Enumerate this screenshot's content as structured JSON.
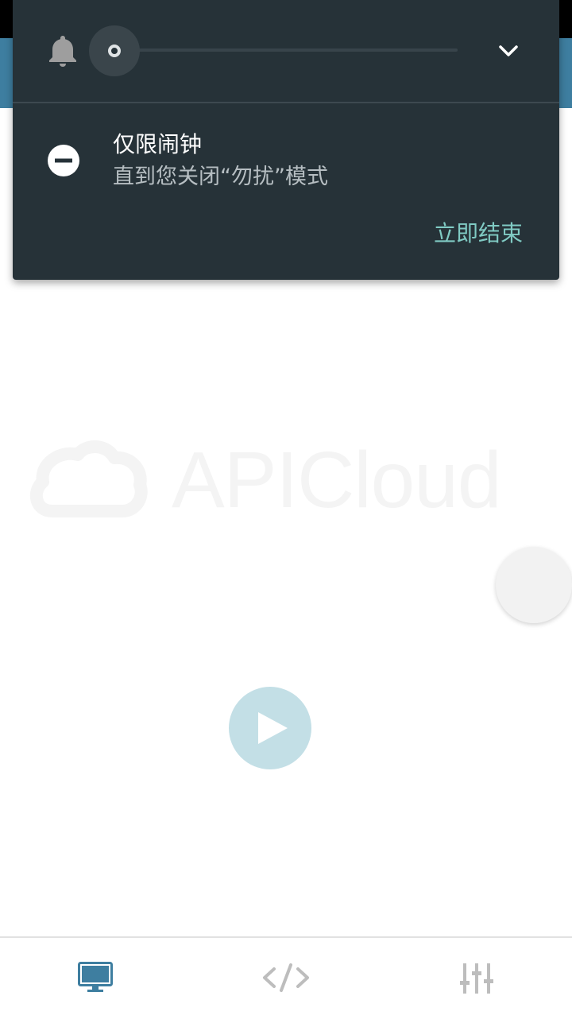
{
  "dnd_panel": {
    "mode_title": "仅限闹钟",
    "mode_subtitle": "直到您关闭“勿扰”模式",
    "end_now_label": "立即结束",
    "volume_level": 0,
    "accent_color": "#80cbc4",
    "icons": {
      "bell": "bell-icon",
      "expand": "chevron-down-icon",
      "mode": "minus-circle-icon"
    }
  },
  "watermark": {
    "text": "APICloud"
  },
  "bottom_nav": {
    "items": [
      {
        "icon": "monitor-icon",
        "active": true,
        "color": "#3e7ea0"
      },
      {
        "icon": "code-icon",
        "active": false,
        "color": "#bdbdbd"
      },
      {
        "icon": "sliders-icon",
        "active": false,
        "color": "#bdbdbd"
      }
    ]
  },
  "colors": {
    "header": "#3e7ea0",
    "panel_bg": "#263238",
    "play_button": "#c3dfe6"
  }
}
